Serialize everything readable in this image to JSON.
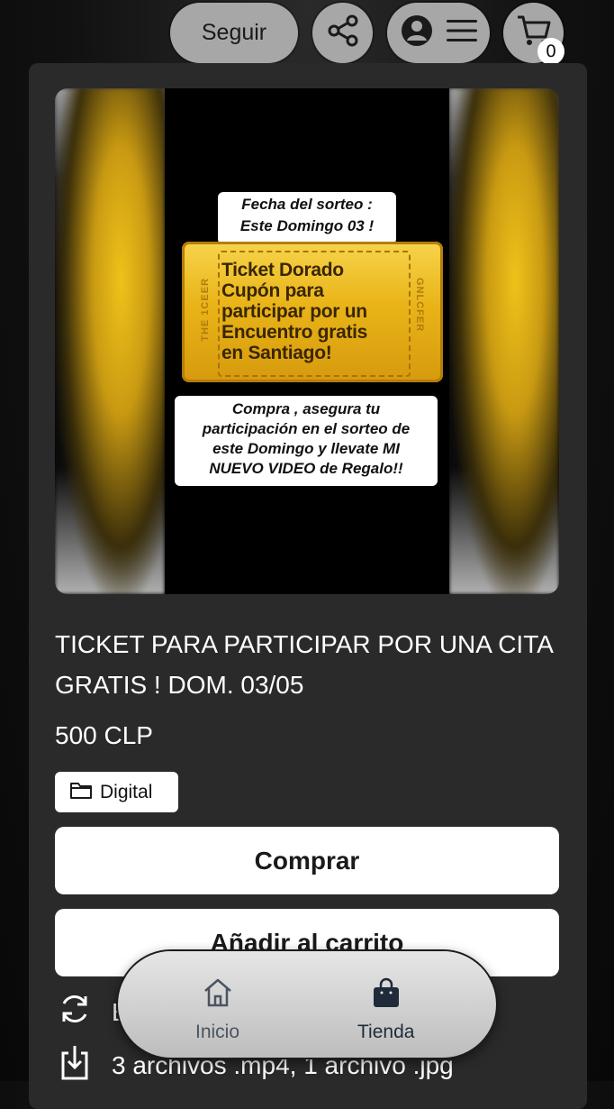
{
  "header": {
    "follow_label": "Seguir",
    "cart_count": "0",
    "icons": [
      "share-icon",
      "profile-icon",
      "menu-icon",
      "cart-icon"
    ]
  },
  "media": {
    "top_label_lines": [
      "Fecha del sorteo :",
      "Este Domingo 03 !"
    ],
    "ticket_text_lines": [
      "Ticket Dorado",
      "Cupón para",
      "participar por un",
      "Encuentro gratis",
      "en Santiago!"
    ],
    "ticket_side_left": "THE 1CEER",
    "ticket_side_right": "GNLCFER",
    "bottom_label_lines": [
      "Compra , asegura tu",
      "participación en el sorteo de",
      "este Domingo y llevate MI",
      "NUEVO VIDEO de Regalo!!"
    ]
  },
  "product": {
    "title": "TICKET PARA PARTICIPAR POR UNA CITA GRATIS ! DOM. 03/05",
    "price": "500 CLP",
    "type_badge": "Digital",
    "buy_label": "Comprar",
    "add_to_cart_label": "Añadir al carrito",
    "feature_1": "E",
    "feature_2": "3 archivos .mp4, 1 archivo .jpg"
  },
  "bottom_nav": {
    "home_label": "Inicio",
    "shop_label": "Tienda"
  },
  "colors": {
    "background": "#0b0b0b",
    "card": "#2a2a2a",
    "pill": "#a7a7a7",
    "ticket_gold": "#e9b418"
  }
}
